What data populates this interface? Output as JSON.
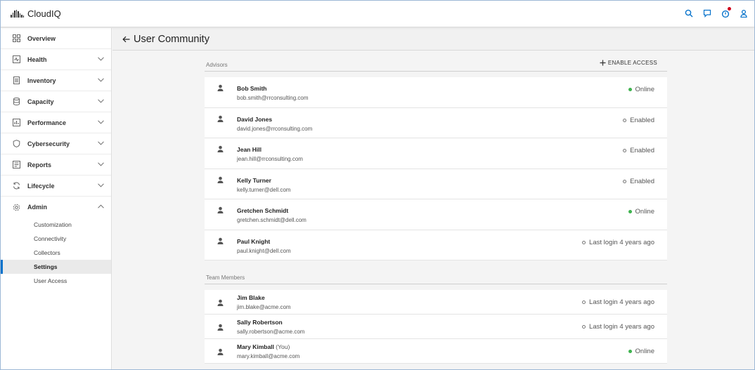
{
  "app": {
    "name": "CloudIQ"
  },
  "header_icons": [
    "search-icon",
    "chat-icon",
    "notification-icon",
    "user-icon"
  ],
  "colors": {
    "accent": "#0672cb",
    "online": "#3fb34f",
    "notification": "#d0021b"
  },
  "sidebar": {
    "items": [
      {
        "label": "Overview",
        "icon": "overview-icon"
      },
      {
        "label": "Health",
        "icon": "health-icon"
      },
      {
        "label": "Inventory",
        "icon": "inventory-icon"
      },
      {
        "label": "Capacity",
        "icon": "capacity-icon"
      },
      {
        "label": "Performance",
        "icon": "performance-icon"
      },
      {
        "label": "Cybersecurity",
        "icon": "shield-icon"
      },
      {
        "label": "Reports",
        "icon": "reports-icon"
      },
      {
        "label": "Lifecycle",
        "icon": "lifecycle-icon"
      },
      {
        "label": "Admin",
        "icon": "gear-icon"
      }
    ],
    "admin_sub": [
      {
        "label": "Customization"
      },
      {
        "label": "Connectivity"
      },
      {
        "label": "Collectors"
      },
      {
        "label": "Settings"
      },
      {
        "label": "User Access"
      }
    ]
  },
  "page": {
    "title": "User Community"
  },
  "advisors": {
    "title": "Advisors",
    "enable_label": "ENABLE ACCESS",
    "rows": [
      {
        "name": "Bob Smith",
        "email": "bob.smith@rrconsulting.com",
        "status": "Online"
      },
      {
        "name": "David Jones",
        "email": "david.jones@rrconsulting.com",
        "status": "Enabled"
      },
      {
        "name": "Jean Hill",
        "email": "jean.hill@rrconsulting.com",
        "status": "Enabled"
      },
      {
        "name": "Kelly Turner",
        "email": "kelly.turner@dell.com",
        "status": "Enabled"
      },
      {
        "name": "Gretchen Schmidt",
        "email": "gretchen.schmidt@dell.com",
        "status": "Online"
      },
      {
        "name": "Paul Knight",
        "email": "paul.knight@dell.com",
        "status": "Last login 4 years ago"
      }
    ]
  },
  "team": {
    "title": "Team Members",
    "rows": [
      {
        "name": "Jim Blake",
        "email": "jim.blake@acme.com",
        "status": "Last login 4 years ago"
      },
      {
        "name": "Sally Robertson",
        "email": "sally.robertson@acme.com",
        "status": "Last login 4 years ago"
      },
      {
        "name": "Mary Kimball",
        "you": "(You)",
        "email": "mary.kimball@acme.com",
        "status": "Online"
      }
    ]
  }
}
